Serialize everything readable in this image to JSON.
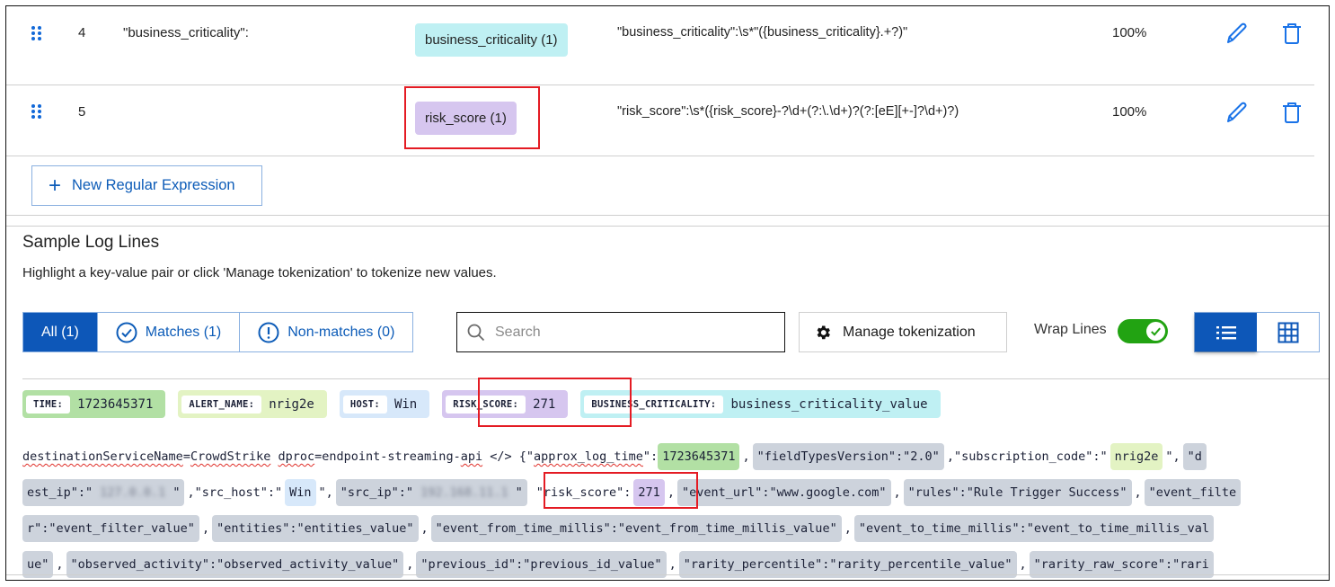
{
  "regex_rows": [
    {
      "number": "4",
      "key": "\"business_criticality\":",
      "token_label": "business_criticality (1)",
      "pattern": "\"business_criticality\":\\s*\"({business_criticality}.+?)\"",
      "match_percent": "100%"
    },
    {
      "number": "5",
      "key": "",
      "token_label": "risk_score (1)",
      "pattern": "\"risk_score\":\\s*({risk_score}-?\\d+(?:\\.\\d+)?(?:[eE][+-]?\\d+)?)",
      "match_percent": "100%"
    }
  ],
  "new_regex_button": "New Regular Expression",
  "sample_section": {
    "title": "Sample Log Lines",
    "subtitle": "Highlight a key-value pair or click 'Manage tokenization' to tokenize new values."
  },
  "filters": {
    "all": "All (1)",
    "matches": "Matches (1)",
    "non_matches": "Non-matches (0)",
    "active": "all"
  },
  "search": {
    "placeholder": "Search",
    "value": ""
  },
  "manage_button": "Manage tokenization",
  "wrap_lines": {
    "label": "Wrap Lines",
    "on": true
  },
  "view_mode": {
    "active": "list",
    "options": [
      "list",
      "grid"
    ]
  },
  "tokens": [
    {
      "key": "TIME:",
      "value": "1723645371",
      "color": "#b2e0a4"
    },
    {
      "key": "ALERT_NAME:",
      "value": "nrig2e",
      "color": "#e3f3c3"
    },
    {
      "key": "HOST:",
      "value": "Win",
      "color": "#d7e8fa"
    },
    {
      "key": "RISK_SCORE:",
      "value": "271",
      "color": "#d6c6ef"
    },
    {
      "key": "BUSINESS_CRITICALITY:",
      "value": "business_criticality_value",
      "color": "#bff0f3"
    }
  ],
  "log": {
    "l1": {
      "a": "destinationServiceName",
      "b": "=",
      "c": "CrowdStrike",
      "d": " ",
      "e": "dproc",
      "f": "=endpoint-streaming-",
      "g": "api",
      "h": " </> {\"",
      "i": "approx_log_time",
      "j": "\":",
      "time": "1723645371",
      "k": ",",
      "ftv": "\"fieldTypesVersion\":\"2.0\"",
      "l": ",\"subscription_code\":\"",
      "alert": "nrig2e",
      "m": "\",",
      "n": "\"d"
    },
    "l2": {
      "a": "est_ip\":\"",
      "a_blur": "127.0.0.1",
      "a_end": "\"",
      "b": ",\"src_host\":\"",
      "host": "Win",
      "c": "\",",
      "d": "\"src_ip\":\"",
      "d_blur": "192.168.11.1",
      "d_end": "\"",
      "e": "\"risk_score\":",
      "risk": "271",
      "f": ",",
      "g": "\"event_url\":\"www.google.com\"",
      "h": ",",
      "i": "\"rules\":\"Rule Trigger Success\"",
      "j": ",",
      "k": "\"event_filte"
    },
    "l3": {
      "a": "r\":\"event_filter_value\"",
      "b": ",",
      "c": "\"entities\":\"entities_value\"",
      "d": ",",
      "e": "\"event_from_time_millis\":\"event_from_time_millis_value\"",
      "f": ",",
      "g": "\"event_to_time_millis\":\"event_to_time_millis_val"
    },
    "l4": {
      "a": "ue\"",
      "b": ",",
      "c": "\"observed_activity\":\"observed_activity_value\"",
      "d": ",",
      "e": "\"previous_id\":\"previous_id_value\"",
      "f": ",",
      "g": "\"rarity_percentile\":\"rarity_percentile_value\"",
      "h": ",",
      "i": "\"rarity_raw_score\":\"rari"
    }
  },
  "colors": {
    "accent": "#0d57b8",
    "toggle_on": "#22a312",
    "highlight_box": "#e41b23",
    "business_criticality": "#bff0f3",
    "risk_score": "#d6c6ef"
  }
}
